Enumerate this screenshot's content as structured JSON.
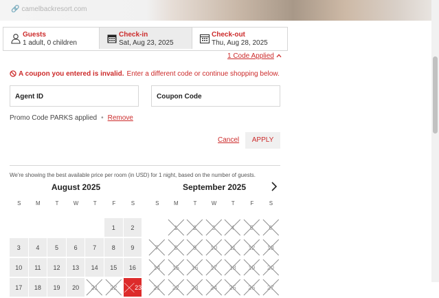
{
  "banner": {
    "url_text": "camelbackresort.com"
  },
  "booking_bar": {
    "guests": {
      "title": "Guests",
      "value": "1 adult, 0 children"
    },
    "checkin": {
      "title": "Check-in",
      "value": "Sat, Aug 23, 2025"
    },
    "checkout": {
      "title": "Check-out",
      "value": "Thu, Aug 28, 2025"
    }
  },
  "coupon": {
    "toggle_label": "1 Code Applied",
    "error_strong": "A coupon you entered is invalid.",
    "error_rest": "Enter a different code or continue shopping below.",
    "agent_label": "Agent ID",
    "coupon_label": "Coupon Code",
    "promo_text": "Promo Code PARKS applied",
    "remove_label": "Remove",
    "cancel_label": "Cancel",
    "apply_label": "APPLY"
  },
  "info_text": "We're showing the best available price per room (in USD) for 1 night, based on the number of guests.",
  "calendar": {
    "weekdays": [
      "S",
      "M",
      "T",
      "W",
      "T",
      "F",
      "S"
    ],
    "months": [
      {
        "title": "August 2025",
        "leading_blanks": 5,
        "days": [
          {
            "d": "1",
            "s": "avail"
          },
          {
            "d": "2",
            "s": "avail"
          },
          {
            "d": "3",
            "s": "avail"
          },
          {
            "d": "4",
            "s": "avail"
          },
          {
            "d": "5",
            "s": "avail"
          },
          {
            "d": "6",
            "s": "avail"
          },
          {
            "d": "7",
            "s": "avail"
          },
          {
            "d": "8",
            "s": "avail"
          },
          {
            "d": "9",
            "s": "avail"
          },
          {
            "d": "10",
            "s": "avail"
          },
          {
            "d": "11",
            "s": "avail"
          },
          {
            "d": "12",
            "s": "avail"
          },
          {
            "d": "13",
            "s": "avail"
          },
          {
            "d": "14",
            "s": "avail"
          },
          {
            "d": "15",
            "s": "avail"
          },
          {
            "d": "16",
            "s": "avail"
          },
          {
            "d": "17",
            "s": "avail"
          },
          {
            "d": "18",
            "s": "avail"
          },
          {
            "d": "19",
            "s": "avail"
          },
          {
            "d": "20",
            "s": "avail"
          },
          {
            "d": "21",
            "s": "unavail"
          },
          {
            "d": "22",
            "s": "unavail"
          },
          {
            "d": "23",
            "s": "selected"
          }
        ]
      },
      {
        "title": "September 2025",
        "leading_blanks": 1,
        "days": [
          {
            "d": "1",
            "s": "unavail"
          },
          {
            "d": "2",
            "s": "unavail"
          },
          {
            "d": "3",
            "s": "unavail"
          },
          {
            "d": "4",
            "s": "unavail"
          },
          {
            "d": "5",
            "s": "unavail"
          },
          {
            "d": "6",
            "s": "unavail"
          },
          {
            "d": "7",
            "s": "unavail"
          },
          {
            "d": "8",
            "s": "unavail"
          },
          {
            "d": "9",
            "s": "unavail"
          },
          {
            "d": "10",
            "s": "unavail"
          },
          {
            "d": "11",
            "s": "unavail"
          },
          {
            "d": "12",
            "s": "unavail"
          },
          {
            "d": "13",
            "s": "unavail"
          },
          {
            "d": "14",
            "s": "unavail"
          },
          {
            "d": "15",
            "s": "unavail"
          },
          {
            "d": "16",
            "s": "unavail"
          },
          {
            "d": "17",
            "s": "unavail"
          },
          {
            "d": "18",
            "s": "unavail"
          },
          {
            "d": "19",
            "s": "unavail"
          },
          {
            "d": "20",
            "s": "unavail"
          },
          {
            "d": "21",
            "s": "unavail"
          },
          {
            "d": "22",
            "s": "unavail"
          },
          {
            "d": "23",
            "s": "unavail"
          },
          {
            "d": "24",
            "s": "unavail"
          },
          {
            "d": "25",
            "s": "unavail"
          },
          {
            "d": "26",
            "s": "unavail"
          },
          {
            "d": "27",
            "s": "unavail"
          }
        ]
      }
    ]
  },
  "colors": {
    "accent": "#cc2a2a",
    "selected": "#dd2b2b",
    "cell": "#ececec"
  },
  "icons": [
    "link-icon",
    "person-icon",
    "calendar-icon",
    "chevron-up-icon",
    "error-circle-icon",
    "chevron-right-icon"
  ]
}
